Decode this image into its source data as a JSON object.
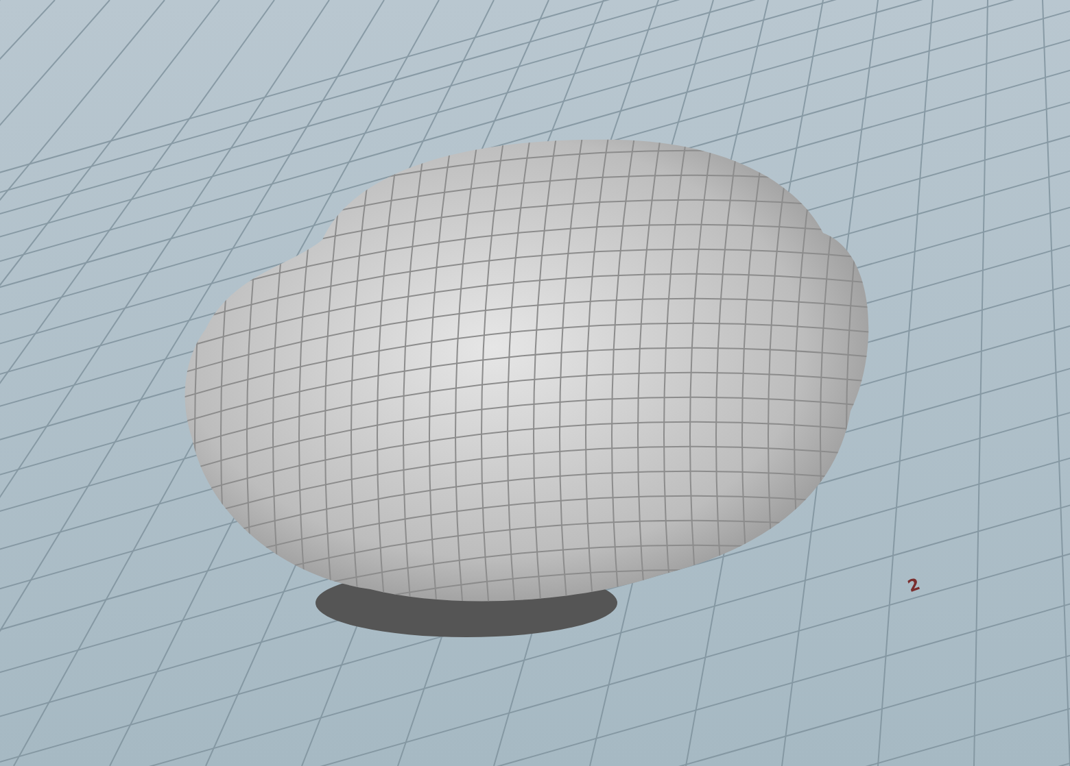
{
  "viewport": {
    "grid_labels": [
      {
        "text": "2"
      }
    ]
  }
}
